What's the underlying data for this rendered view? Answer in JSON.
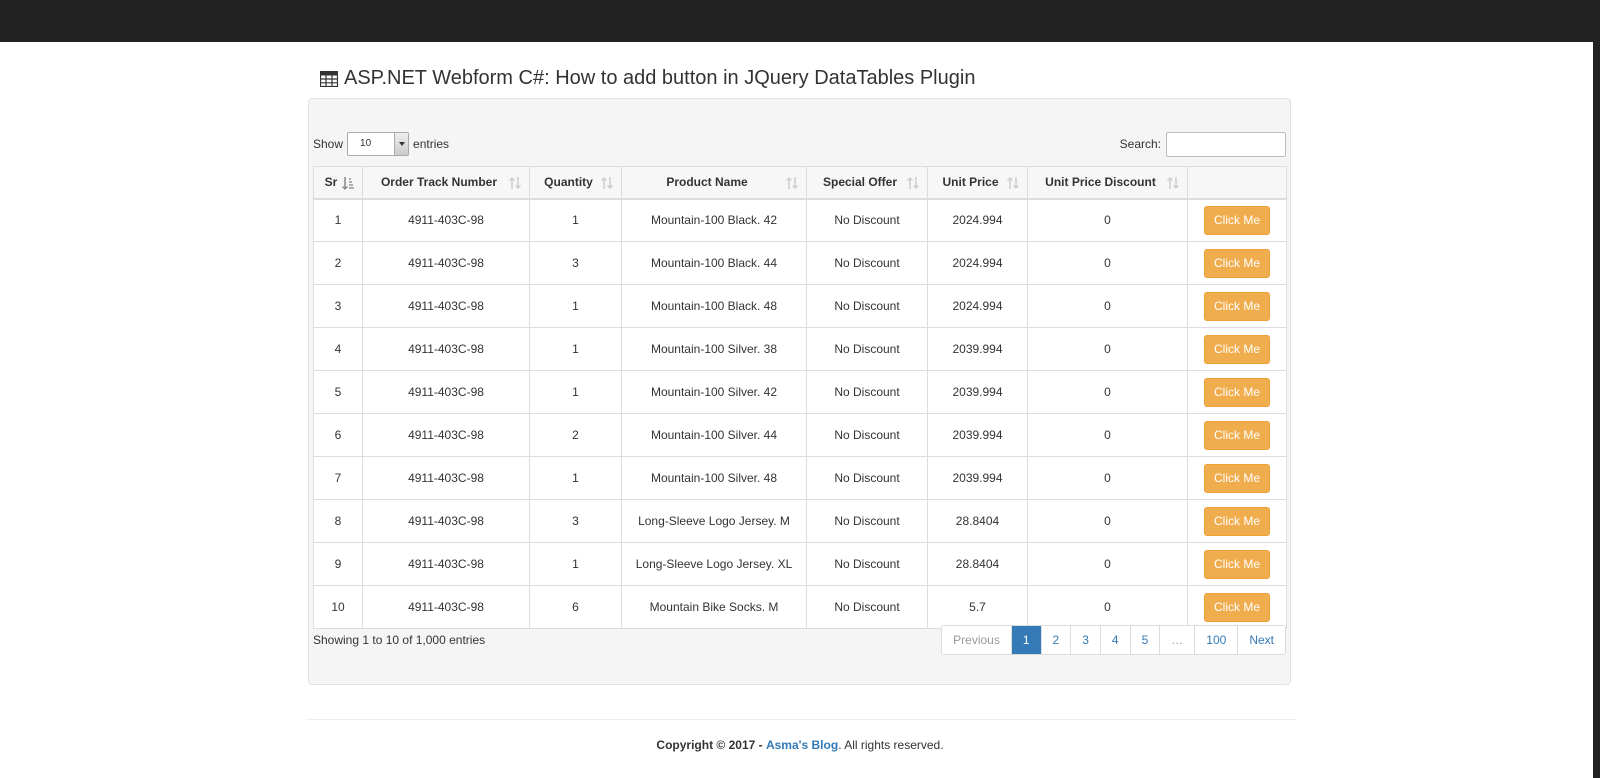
{
  "page": {
    "title": "ASP.NET Webform C#: How to add button in JQuery DataTables Plugin",
    "title_icon": "table-icon"
  },
  "length_menu": {
    "prefix": "Show",
    "value": "10",
    "suffix": "entries"
  },
  "search": {
    "label": "Search:",
    "value": ""
  },
  "table": {
    "headers": [
      "Sr",
      "Order Track Number",
      "Quantity",
      "Product Name",
      "Special Offer",
      "Unit Price",
      "Unit Price Discount",
      ""
    ],
    "button_label": "Click Me",
    "rows": [
      [
        "1",
        "4911-403C-98",
        "1",
        "Mountain-100 Black. 42",
        "No Discount",
        "2024.994",
        "0"
      ],
      [
        "2",
        "4911-403C-98",
        "3",
        "Mountain-100 Black. 44",
        "No Discount",
        "2024.994",
        "0"
      ],
      [
        "3",
        "4911-403C-98",
        "1",
        "Mountain-100 Black. 48",
        "No Discount",
        "2024.994",
        "0"
      ],
      [
        "4",
        "4911-403C-98",
        "1",
        "Mountain-100 Silver. 38",
        "No Discount",
        "2039.994",
        "0"
      ],
      [
        "5",
        "4911-403C-98",
        "1",
        "Mountain-100 Silver. 42",
        "No Discount",
        "2039.994",
        "0"
      ],
      [
        "6",
        "4911-403C-98",
        "2",
        "Mountain-100 Silver. 44",
        "No Discount",
        "2039.994",
        "0"
      ],
      [
        "7",
        "4911-403C-98",
        "1",
        "Mountain-100 Silver. 48",
        "No Discount",
        "2039.994",
        "0"
      ],
      [
        "8",
        "4911-403C-98",
        "3",
        "Long-Sleeve Logo Jersey. M",
        "No Discount",
        "28.8404",
        "0"
      ],
      [
        "9",
        "4911-403C-98",
        "1",
        "Long-Sleeve Logo Jersey. XL",
        "No Discount",
        "28.8404",
        "0"
      ],
      [
        "10",
        "4911-403C-98",
        "6",
        "Mountain Bike Socks. M",
        "No Discount",
        "5.7",
        "0"
      ]
    ]
  },
  "info": "Showing 1 to 10 of 1,000 entries",
  "pagination": {
    "previous": "Previous",
    "pages": [
      "1",
      "2",
      "3",
      "4",
      "5",
      "…",
      "100"
    ],
    "active": "1",
    "next": "Next"
  },
  "footer": {
    "copyright": "Copyright © 2017 -",
    "blog": "Asma's Blog",
    "rights": ". All rights reserved."
  },
  "colors": {
    "topbar": "#222222",
    "button": "#f0ad4e",
    "accent": "#337ab7",
    "panel": "#f5f5f5"
  }
}
